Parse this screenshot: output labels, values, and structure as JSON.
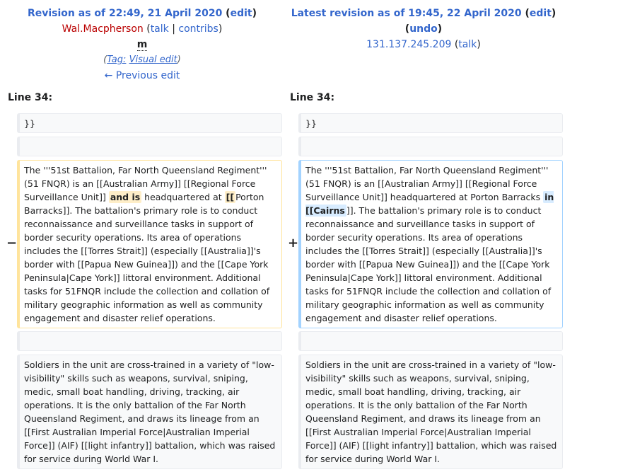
{
  "left": {
    "revision_prefix": "Revision as of 22:49, 21 April 2020",
    "edit": "edit",
    "user": "Wal.Macpherson",
    "talk": "talk",
    "contribs": "contribs",
    "minor_mark": "m",
    "tag_label": "Tag:",
    "tag_value": "Visual edit",
    "prev_edit": "← Previous edit"
  },
  "right": {
    "revision_prefix": "Latest revision as of 19:45, 22 April 2020",
    "edit": "edit",
    "undo": "undo",
    "user": "131.137.245.209",
    "talk": "talk"
  },
  "line_label": "Line 34:",
  "rows": {
    "braces": "}}",
    "del_parts": [
      "The '''51st Battalion, Far North Queensland Regiment''' (51 FNQR) is an [[Australian Army]] [[Regional Force Surveillance Unit]]",
      "and is",
      "headquartered at",
      "[[",
      "Porton Barracks]]. The battalion's primary role is to conduct reconnaissance and surveillance tasks in support of border security operations. Its area of operations includes the [[Torres Strait]] (especially [[Australia]]'s border with [[Papua New Guinea]]) and the [[Cape York Peninsula|Cape York]] littoral environment. Additional tasks for 51FNQR include the collection and collation of military geographic information as well as community engagement and disaster relief operations."
    ],
    "add_parts": [
      "The '''51st Battalion, Far North Queensland Regiment''' (51 FNQR) is an [[Australian Army]] [[Regional Force Surveillance Unit]] headquartered at Porton Barracks",
      "in [[Cairns",
      "]]. The battalion's primary role is to conduct reconnaissance and surveillance tasks in support of border security operations. Its area of operations includes the [[Torres Strait]] (especially [[Australia]]'s border with [[Papua New Guinea]]) and the [[Cape York Peninsula|Cape York]] littoral environment. Additional tasks for 51FNQR include the collection and collation of military geographic information as well as community engagement and disaster relief operations."
    ],
    "soldiers": "Soldiers in the unit are cross-trained in a variety of \"low-visibility\" skills such as weapons, survival, sniping, medic, small boat handling, driving, tracking, air operations. It is the only battalion of the Far North Queensland Regiment, and draws its lineage from an [[First Australian Imperial Force|Australian Imperial Force]] (AIF) [[light infantry]] battalion, which was raised for service during World War I."
  },
  "markers": {
    "minus": "−",
    "plus": "+"
  },
  "colors": {
    "link": "#3366cc",
    "user_red": "#ba0000",
    "del_border": "#ffe49c",
    "add_border": "#a3d3ff"
  }
}
